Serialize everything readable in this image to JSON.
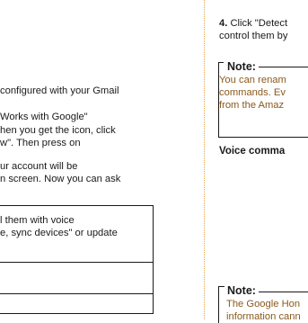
{
  "left": {
    "lines": [
      "configured with your Gmail",
      "Works with Google\"",
      "hen you get the icon, click",
      "w\". Then press on",
      "ur account will be",
      "n screen. Now you can ask"
    ],
    "box_lines": [
      "l them with voice",
      "e, sync devices\" or update"
    ]
  },
  "right": {
    "step_num": "4.",
    "step_text_1": " Click \"Detect",
    "step_text_2": "control them by",
    "note1": {
      "title": "Note:",
      "lines": [
        "You can renam",
        "commands. Ev",
        "from the Amaz"
      ]
    },
    "section_heading": "Voice comma",
    "note2": {
      "title": "Note:",
      "lines": [
        "The Google Hon",
        "information cann"
      ]
    }
  },
  "colors": {
    "accent": "#e8a347",
    "note_text": "#8a5a1c",
    "body_text": "#1a1a1a"
  }
}
